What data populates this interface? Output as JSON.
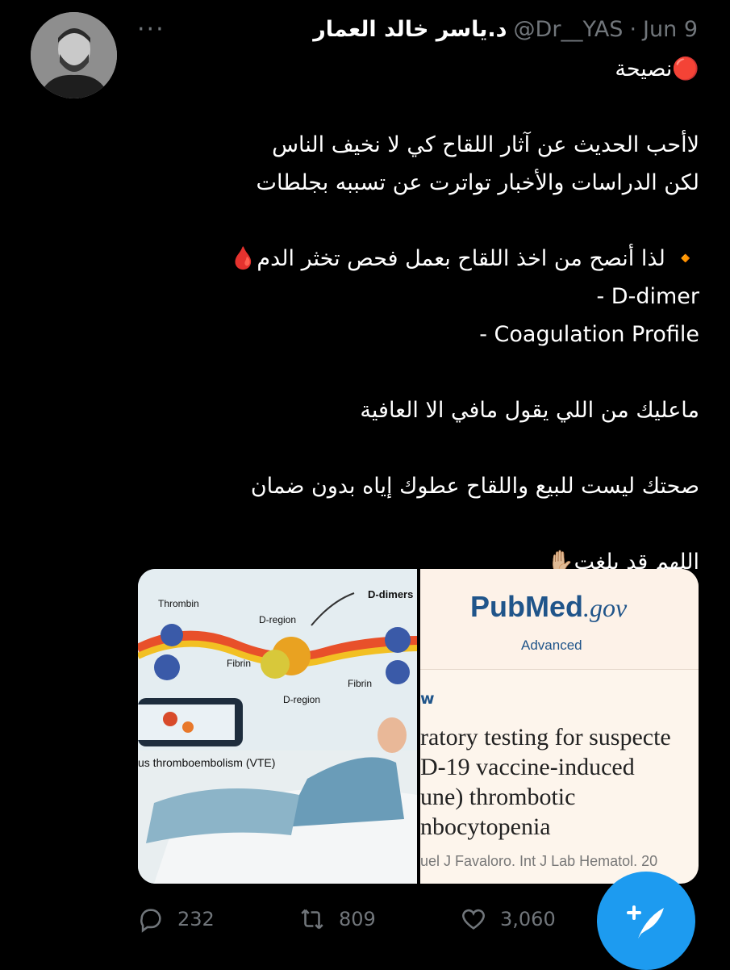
{
  "author": {
    "name": "د.ياسر خالد العمار",
    "handle": "@Dr__YAS",
    "separator": "·",
    "date": "Jun 9"
  },
  "more_label": "···",
  "tweet_lines": [
    "🔴نصيحة",
    "",
    "لاأحب الحديث عن آثار اللقاح كي لا نخيف الناس",
    "لكن الدراسات والأخبار تواترت عن تسببه بجلطات",
    "",
    "🔸 لذا أنصح من اخذ اللقاح بعمل فحص تخثر الدم🩸",
    "- D-dimer",
    "- Coagulation Profile",
    "",
    "ماعليك من اللي يقول مافي الا العافية",
    "",
    "صحتك ليست للبيع واللقاح عطوك إياه بدون ضمان",
    "",
    "اللهم قد بلغت✋🏼"
  ],
  "media_left": {
    "labels": [
      "D-dimers",
      "Thrombin",
      "D-region",
      "Fibrin",
      "D-region",
      "Fibrin",
      "us thromboembolism (VTE)"
    ]
  },
  "media_right": {
    "logo_left": "Pub",
    "logo_right": "Med",
    "logo_gov": ".gov",
    "advanced": "Advanced",
    "badge": "w",
    "title_lines": [
      "ratory testing for suspecte",
      "D-19 vaccine-induced",
      "une) thrombotic",
      "nbocytopenia"
    ],
    "author": "uel J Favaloro. Int J Lab Hematol. 20"
  },
  "actions": {
    "reply_count": "232",
    "retweet_count": "809",
    "like_count": "3,060"
  },
  "fab_label": "+"
}
